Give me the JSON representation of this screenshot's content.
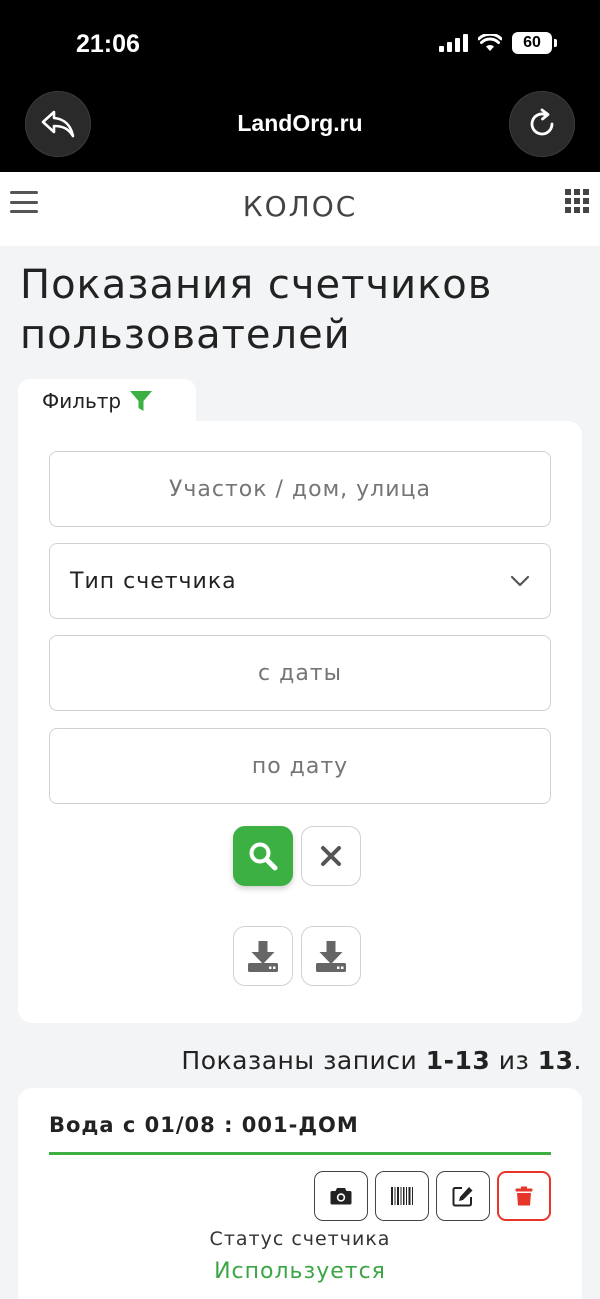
{
  "status_bar": {
    "time": "21:06",
    "battery": "60"
  },
  "browser": {
    "title": "LandOrg.ru"
  },
  "header": {
    "title": "КОЛОС"
  },
  "page": {
    "title": "Показания счетчиков пользователей"
  },
  "filter": {
    "tab_label": "Фильтр",
    "plot_placeholder": "Участок / дом, улица",
    "meter_type_value": "Тип счетчика",
    "date_from_placeholder": "с даты",
    "date_to_placeholder": "по дату"
  },
  "records": {
    "prefix": "Показаны записи",
    "range": "1-13",
    "of": "из",
    "total": "13",
    "suffix": "."
  },
  "card": {
    "title": "Вода с 01/08 : 001-ДОМ",
    "status_label": "Статус счетчика",
    "status_value": "Используется"
  },
  "colors": {
    "accent": "#3cb043",
    "danger": "#e8352a",
    "status": "#3ca646"
  }
}
